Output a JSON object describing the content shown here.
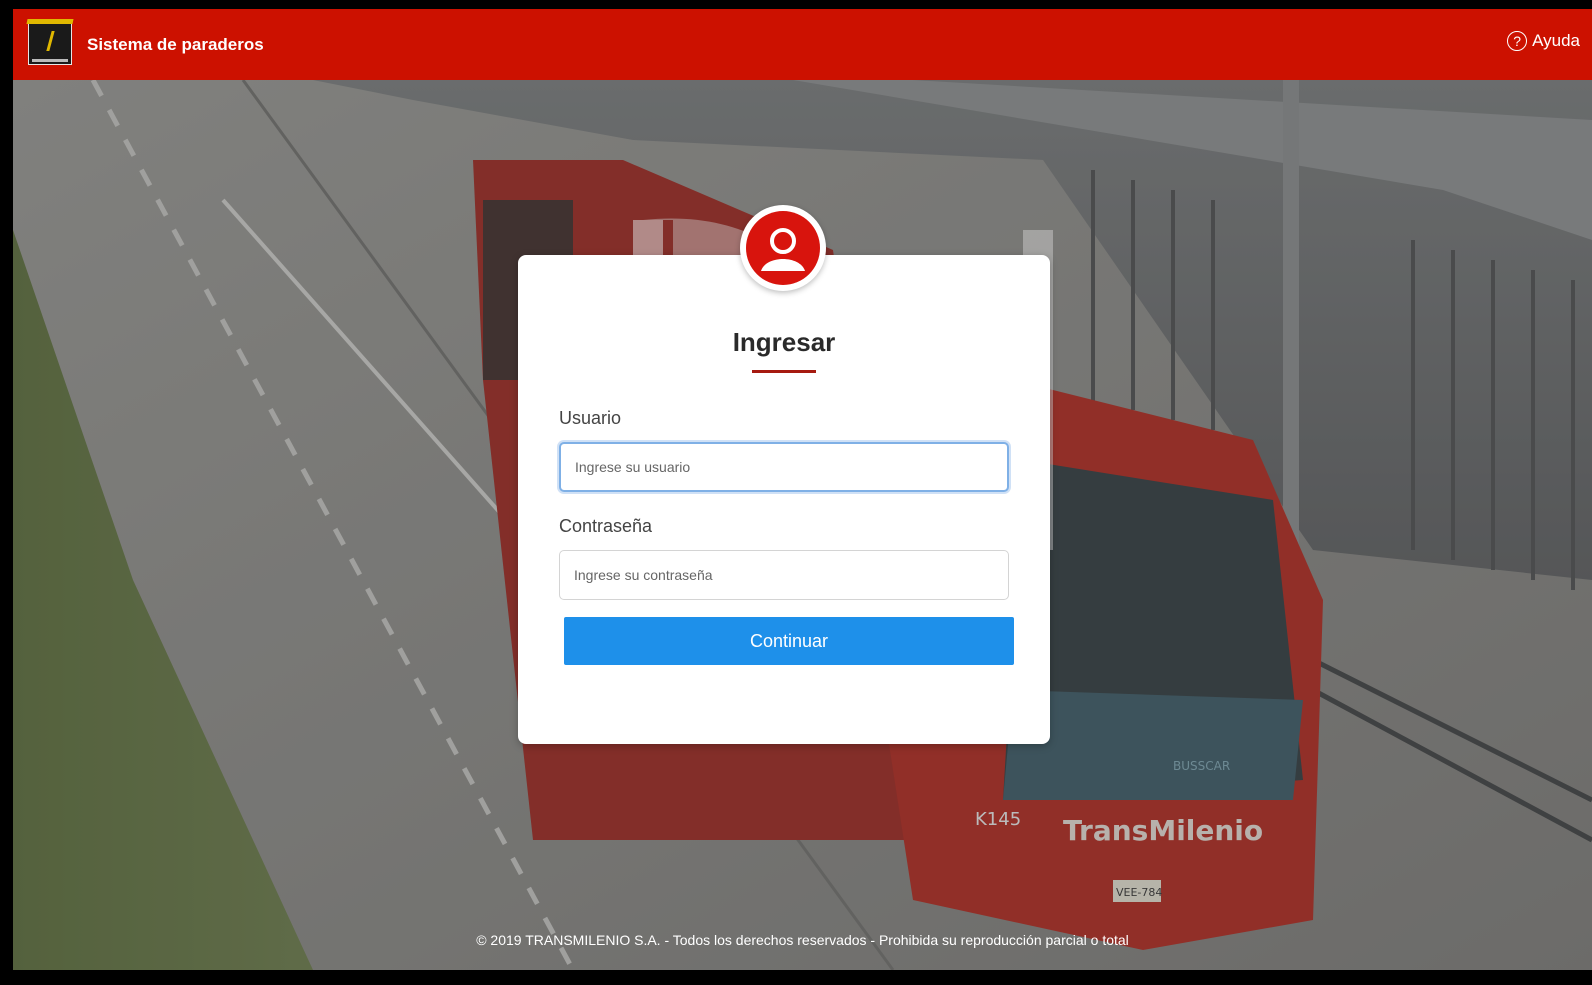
{
  "header": {
    "app_title": "Sistema de paraderos",
    "help_label": "Ayuda",
    "help_icon": "question-circle-icon",
    "logo_icon": "transmilenio-logo"
  },
  "colors": {
    "header_bg": "#cc1100",
    "accent_red": "#d8140d",
    "button_bg": "#1e90ea"
  },
  "login": {
    "avatar_icon": "user-icon",
    "title": "Ingresar",
    "username_label": "Usuario",
    "username_placeholder": "Ingrese su usuario",
    "password_label": "Contraseña",
    "password_placeholder": "Ingrese su contraseña",
    "submit_label": "Continuar"
  },
  "background": {
    "bus_label": "TransMilenio",
    "route_code": "K145",
    "plate": "VEE-784",
    "brand": "BUSSCAR"
  },
  "footer": {
    "text": "© 2019 TRANSMILENIO S.A. - Todos los derechos reservados - Prohibida su reproducción parcial o total"
  }
}
